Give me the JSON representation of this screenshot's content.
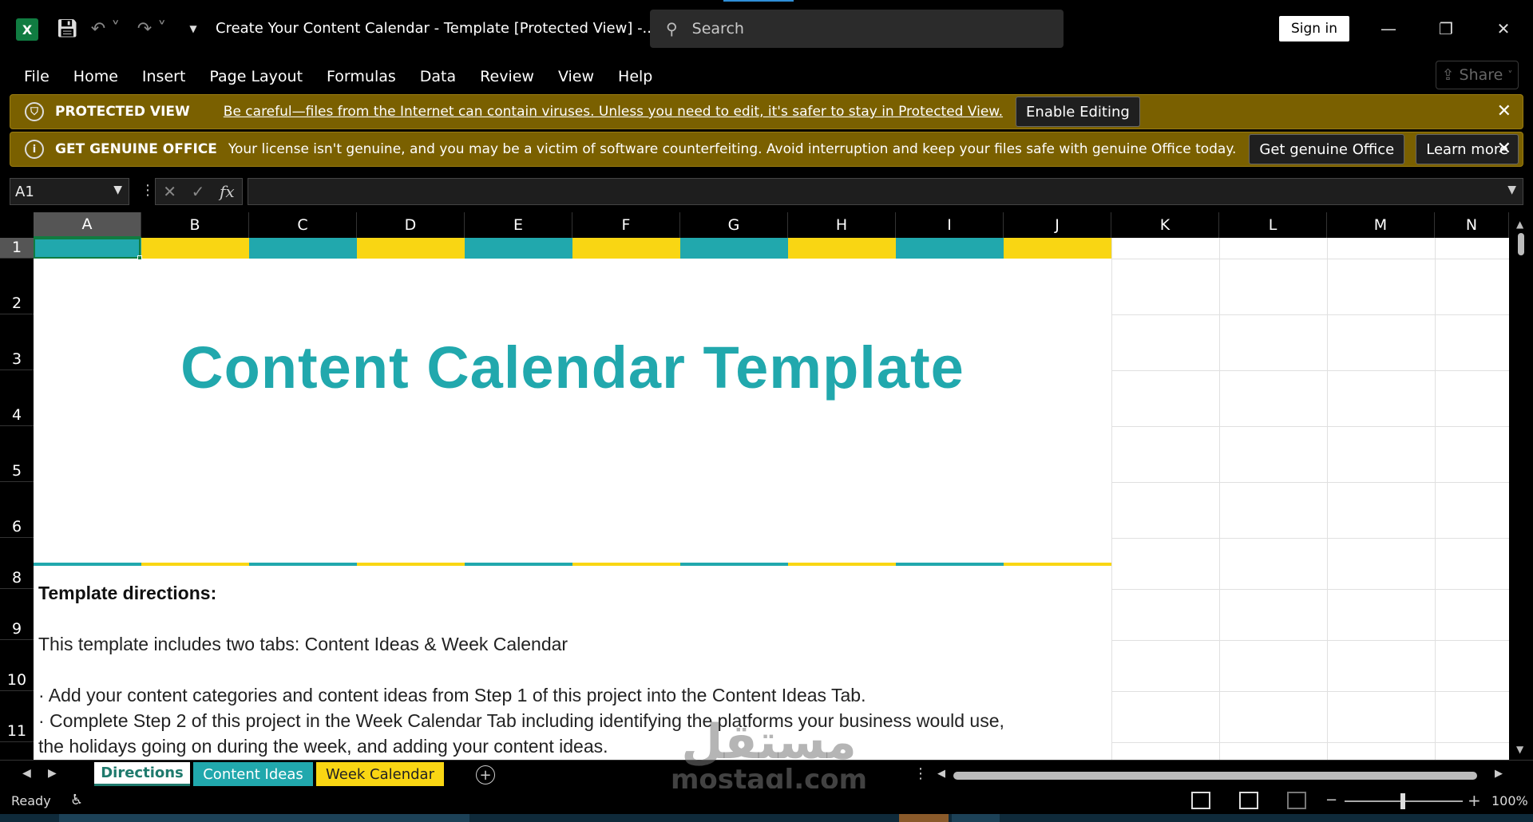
{
  "window": {
    "title": "Create Your Content Calendar - Template  [Protected View]  -...",
    "search_placeholder": "Search",
    "sign_in_label": "Sign in",
    "minimize": "—",
    "restore": "❐",
    "close": "✕"
  },
  "ribbon": {
    "tabs": [
      "File",
      "Home",
      "Insert",
      "Page Layout",
      "Formulas",
      "Data",
      "Review",
      "View",
      "Help"
    ],
    "share_label": "Share"
  },
  "banners": {
    "protected": {
      "title": "PROTECTED VIEW",
      "message": "Be careful—files from the Internet can contain viruses. Unless you need to edit, it's safer to stay in Protected View.",
      "button": "Enable Editing"
    },
    "genuine": {
      "title": "GET GENUINE OFFICE",
      "message": "Your license isn't genuine, and you may be a victim of software counterfeiting. Avoid interruption and keep your files safe with genuine Office today.",
      "button_primary": "Get genuine Office",
      "button_secondary": "Learn more"
    }
  },
  "formula_bar": {
    "name_box": "A1",
    "fx_label": "fx",
    "value": ""
  },
  "grid": {
    "columns": [
      "A",
      "B",
      "C",
      "D",
      "E",
      "F",
      "G",
      "H",
      "I",
      "J",
      "K",
      "L",
      "M",
      "N"
    ],
    "rows": [
      "1",
      "2",
      "3",
      "4",
      "5",
      "6",
      "8",
      "9",
      "10",
      "11"
    ],
    "stripe_colors": [
      "#21a8ad",
      "#f9d613"
    ],
    "title": "Content Calendar Template",
    "directions_heading": "Template directions:",
    "directions_lines": [
      "This template includes two tabs: Content Ideas & Week Calendar",
      "· Add your content categories and content ideas from Step 1 of this project into the Content Ideas Tab.",
      "· Complete Step 2 of this project in the Week Calendar Tab including identifying the platforms your business would use,",
      "the holidays going on during the week, and adding your content ideas."
    ]
  },
  "sheets": {
    "tabs": [
      {
        "label": "Directions",
        "active": true
      },
      {
        "label": "Content Ideas",
        "active": false
      },
      {
        "label": "Week Calendar",
        "active": false
      }
    ]
  },
  "status_bar": {
    "status": "Ready",
    "zoom": "100%"
  },
  "watermark": {
    "arabic": "مستقل",
    "latin": "mostaql.com"
  }
}
